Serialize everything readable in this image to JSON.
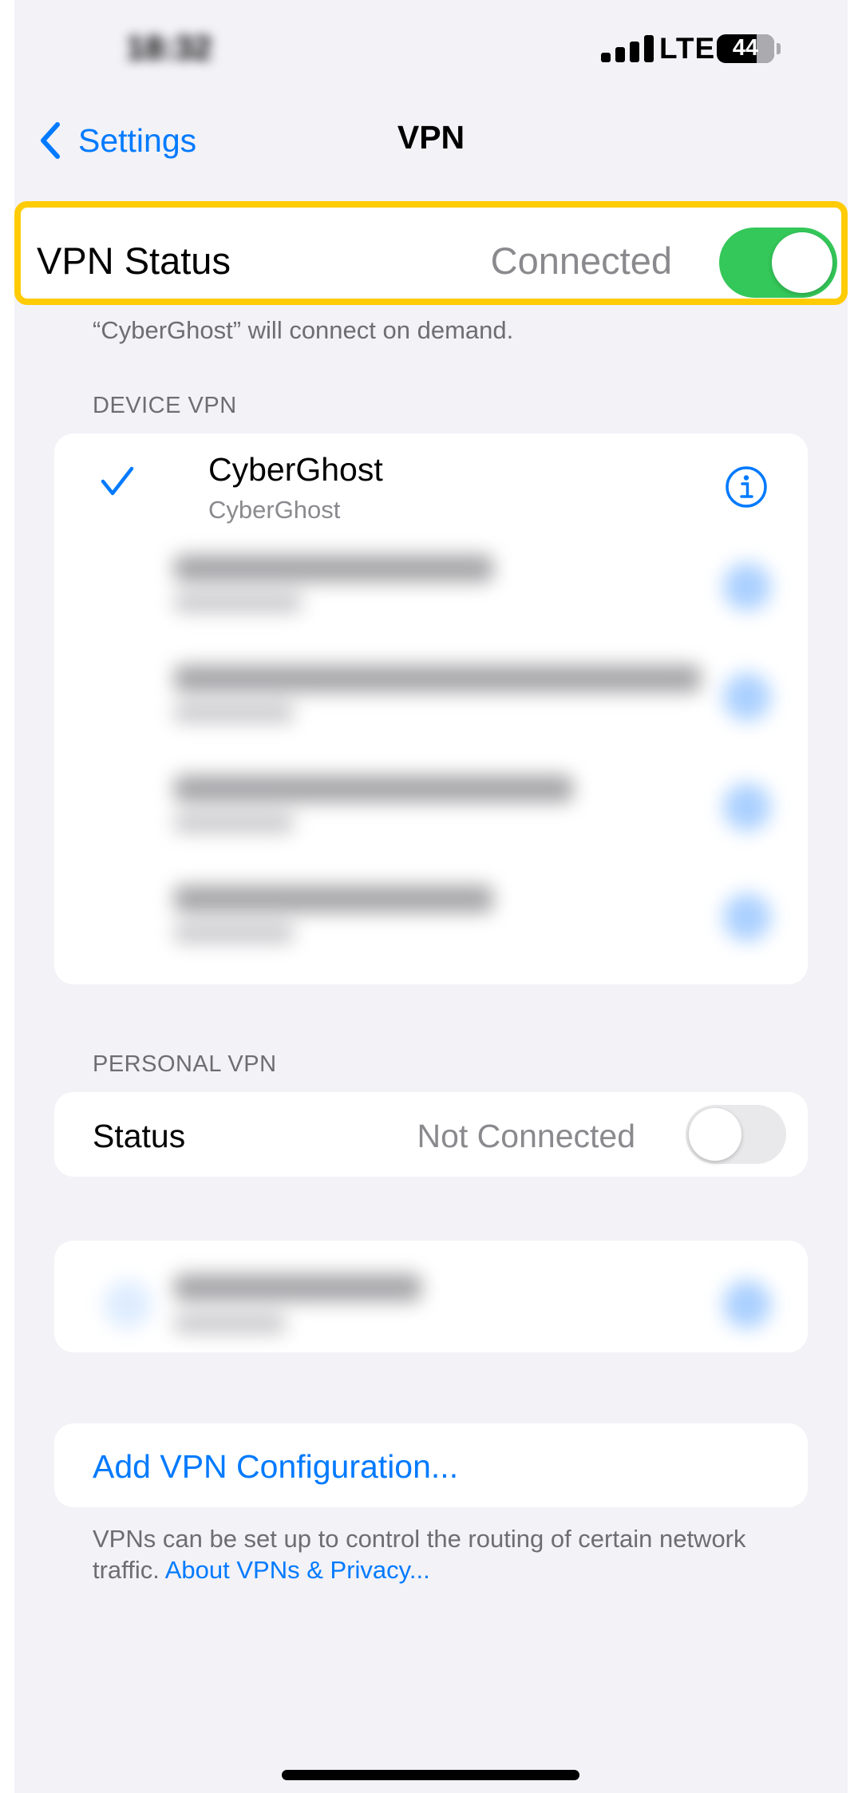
{
  "status_bar": {
    "time": "18:32",
    "network": "LTE",
    "battery_level": "44"
  },
  "nav": {
    "back_label": "Settings",
    "title": "VPN"
  },
  "vpn_status": {
    "label": "VPN Status",
    "value": "Connected",
    "toggle_on": true,
    "footnote": "“CyberGhost” will connect on demand."
  },
  "device_vpn": {
    "header": "DEVICE VPN",
    "selected": {
      "title": "CyberGhost",
      "subtitle": "CyberGhost"
    }
  },
  "personal_vpn": {
    "header": "PERSONAL VPN",
    "status_label": "Status",
    "status_value": "Not Connected",
    "toggle_on": false
  },
  "add_config": {
    "label": "Add VPN Configuration..."
  },
  "footer": {
    "text": "VPNs can be set up to control the routing of certain network traffic.",
    "link": "About VPNs & Privacy..."
  },
  "colors": {
    "accent": "#007aff",
    "toggle_on": "#34c759",
    "highlight": "#ffcb05",
    "background": "#f2f2f7"
  }
}
